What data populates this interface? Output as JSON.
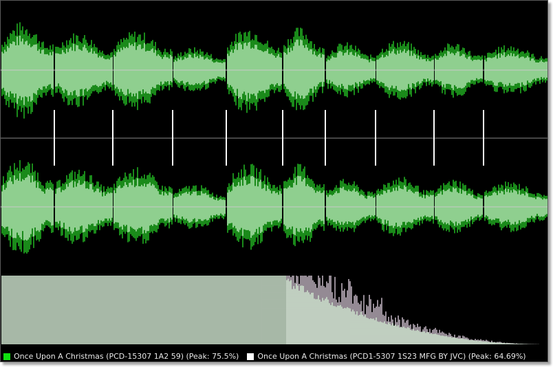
{
  "colors": {
    "background": "#000000",
    "wave_fill": "#8fcf8f",
    "wave_peak": "#1a8a1a",
    "center_line": "#c8c8c8",
    "spectrum_a": "#dff5df",
    "spectrum_b": "#c6b8c6",
    "legend_a": "#10e010",
    "legend_b": "#ffffff"
  },
  "chart_data": {
    "type": "area",
    "segments": 10,
    "segment_levels": [
      0.95,
      0.75,
      0.78,
      0.45,
      0.85,
      0.85,
      0.55,
      0.6,
      0.55,
      0.5
    ],
    "spectrum_decay_start": 0.52
  },
  "legend": [
    {
      "label": "Once Upon A Christmas (PCD-15307 1A2 59) (Peak: 75.5%)",
      "color": "#10e010"
    },
    {
      "label": "Once Upon A Christmas (PCD1-5307 1S23 MFG BY JVC) (Peak: 64.69%)",
      "color": "#ffffff"
    }
  ]
}
